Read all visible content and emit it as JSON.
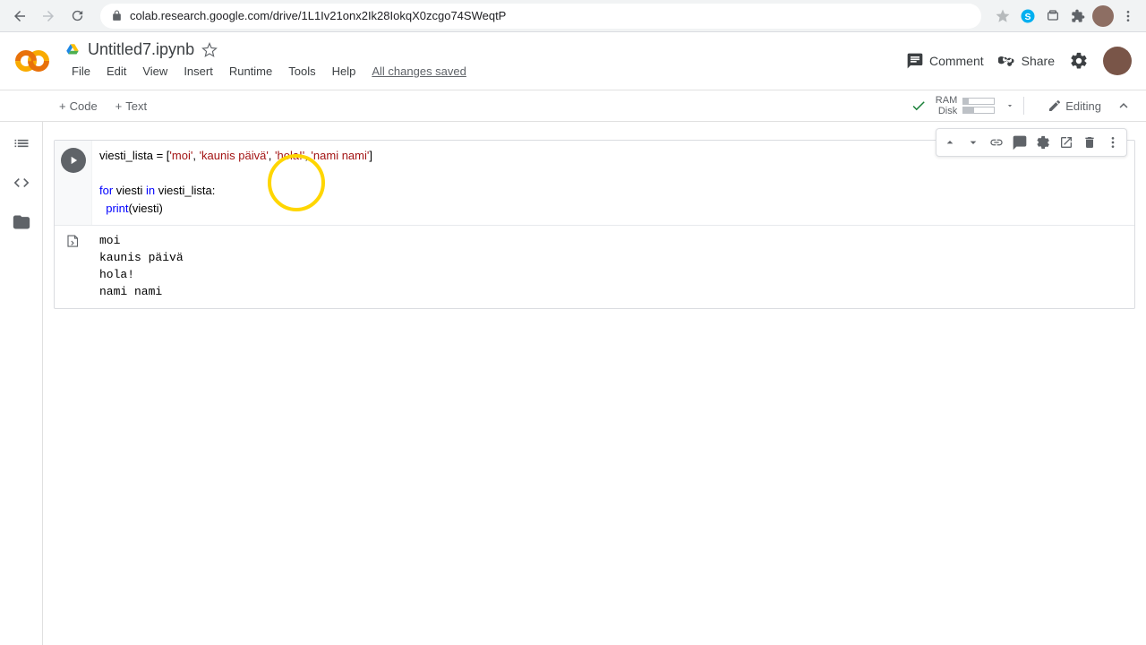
{
  "browser": {
    "url": "colab.research.google.com/drive/1L1Iv21onx2Ik28IokqX0zcgo74SWeqtP"
  },
  "header": {
    "title": "Untitled7.ipynb",
    "menu": {
      "file": "File",
      "edit": "Edit",
      "view": "View",
      "insert": "Insert",
      "runtime": "Runtime",
      "tools": "Tools",
      "help": "Help"
    },
    "saved": "All changes saved",
    "comment": "Comment",
    "share": "Share"
  },
  "toolbar": {
    "code": "Code",
    "text": "Text",
    "ram": "RAM",
    "disk": "Disk",
    "editing": "Editing"
  },
  "code": {
    "line1_pre": "viesti_lista = [",
    "s1": "'moi'",
    "c1": ", ",
    "s2": "'kaunis päivä'",
    "c2": ", ",
    "s3": "'hola!'",
    "c3": ", ",
    "s4": "'nami nami'",
    "line1_post": "]",
    "line2_for": "for",
    "line2_mid": " viesti ",
    "line2_in": "in",
    "line2_end": " viesti_lista:",
    "line3_indent": "  ",
    "line3_fn": "print",
    "line3_args": "(viesti)"
  },
  "output": "moi\nkaunis päivä\nhola!\nnami nami"
}
